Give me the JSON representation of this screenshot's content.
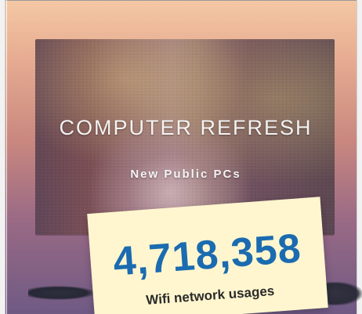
{
  "poster": {
    "title": "COMPUTER REFRESH",
    "subtitle": "New Public PCs"
  },
  "stat_card": {
    "value": "4,718,358",
    "label": "Wifi network usages",
    "value_color": "#1b6bb0",
    "card_color": "#fff6cf"
  }
}
